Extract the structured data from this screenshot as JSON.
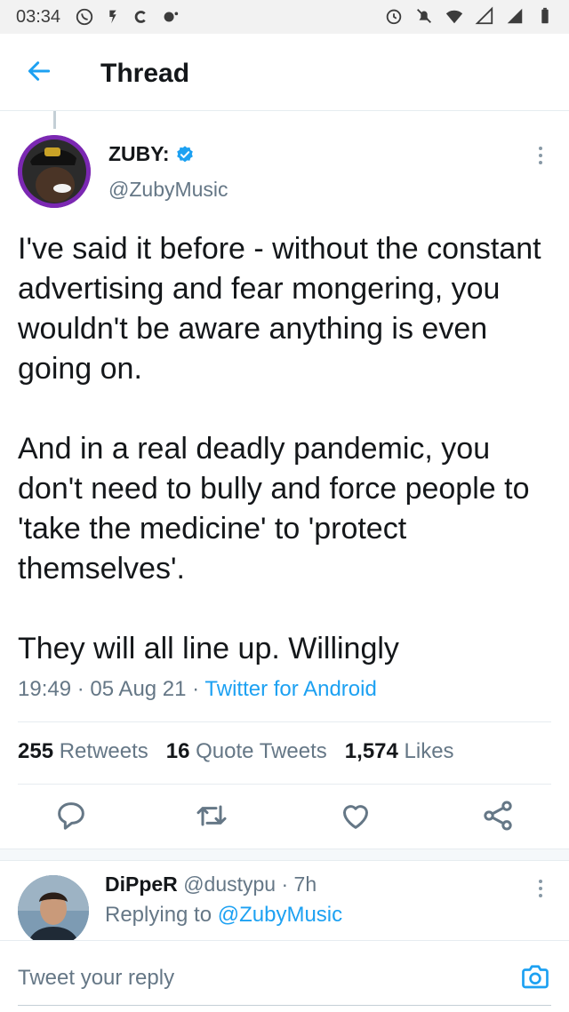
{
  "status_bar": {
    "time": "03:34",
    "left_icons": [
      "whatsapp-icon",
      "sync-icon",
      "c-icon",
      "chat-bubble-icon"
    ],
    "right_icons": [
      "alarm-icon",
      "mute-icon",
      "wifi-icon",
      "no-signal-icon",
      "signal-icon",
      "battery-icon"
    ]
  },
  "header": {
    "title": "Thread"
  },
  "tweet": {
    "author_name": "ZUBY:",
    "author_handle": "@ZubyMusic",
    "paragraphs": [
      "I've said it before - without the constant advertising and fear mongering, you wouldn't be aware anything is even going on.",
      "And in a real deadly pandemic, you don't need to bully and force people to 'take the medicine' to 'protect themselves'.",
      "They will all line up. Willingly"
    ],
    "time": "19:49",
    "date": "05 Aug 21",
    "source": "Twitter for Android",
    "retweets_count": "255",
    "retweets_label": "Retweets",
    "quotes_count": "16",
    "quotes_label": "Quote Tweets",
    "likes_count": "1,574",
    "likes_label": "Likes"
  },
  "reply": {
    "author_name": "DiPpeR",
    "author_handle": "@dustypu",
    "age": "7h",
    "replying_prefix": "Replying to",
    "replying_to": "@ZubyMusic"
  },
  "composer": {
    "placeholder": "Tweet your reply"
  },
  "colors": {
    "accent": "#1da1f2",
    "text": "#14171a",
    "muted": "#657786",
    "verified": "#1da1f2"
  }
}
